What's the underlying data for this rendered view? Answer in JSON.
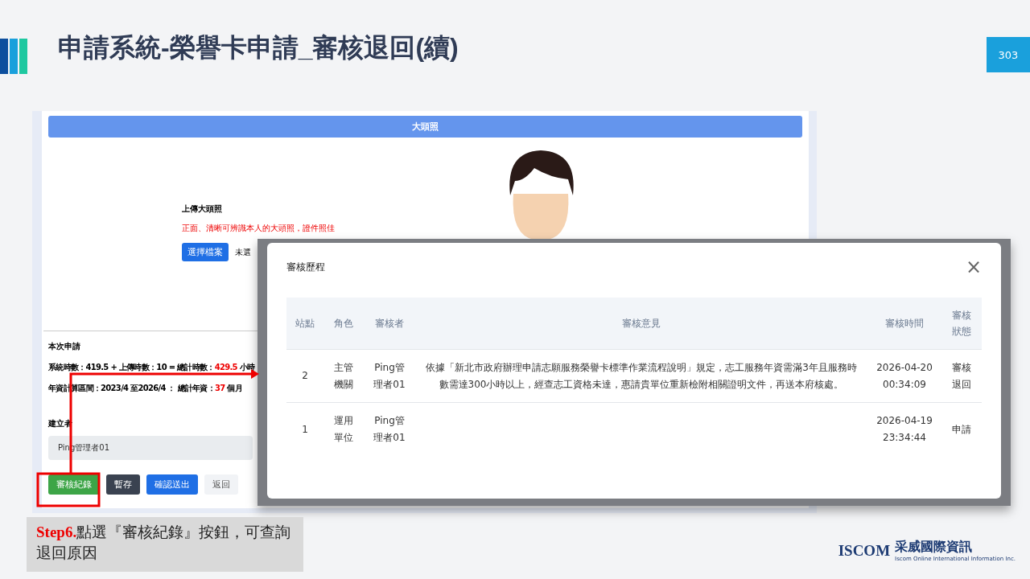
{
  "slide": {
    "title": "申請系統-榮譽卡申請_審核退回(續)",
    "page_number": "303"
  },
  "app": {
    "photo_bar_label": "大頭照",
    "upload_title": "上傳大頭照",
    "upload_hint": "正面、清晰可辨識本人的大頭照，證件照佳",
    "choose_file_button": "選擇檔案",
    "file_status": "未選",
    "summary_title": "本次申請",
    "summary_lines": [
      [
        {
          "text": "系統時數：419.5 + 上傳時數：10 = 總計時數：",
          "emphasis": false
        },
        {
          "text": "429.5",
          "emphasis": true
        },
        {
          "text": " 小時",
          "emphasis": false
        }
      ],
      [
        {
          "text": "年資計算區間：2023/4 至2026/4 ： 總計年資：",
          "emphasis": false
        },
        {
          "text": "37",
          "emphasis": true
        },
        {
          "text": " 個月",
          "emphasis": false
        }
      ]
    ],
    "creator_label": "建立者",
    "creator_value": "Ping管理者01",
    "buttons": [
      {
        "label": "審核紀錄",
        "kind": "success"
      },
      {
        "label": "暫存",
        "kind": "dark"
      },
      {
        "label": "確認送出",
        "kind": "primary"
      },
      {
        "label": "返回",
        "kind": "light"
      }
    ]
  },
  "modal": {
    "title": "審核歷程",
    "close": "×",
    "columns": [
      "站點",
      "角色",
      "審核者",
      "審核意見",
      "審核時間",
      "審核狀態"
    ],
    "rows": [
      {
        "station": "2",
        "role": "主管機關",
        "reviewer": "Ping管理者01",
        "opinion": "依據「新北市政府辦理申請志願服務榮譽卡標準作業流程說明」規定，志工服務年資需滿3年且服務時數需達300小時以上，經查志工資格未達，惠請貴單位重新檢附相關證明文件，再送本府核處。",
        "time": "2026-04-20 00:34:09",
        "status": "審核退回"
      },
      {
        "station": "1",
        "role": "運用單位",
        "reviewer": "Ping管理者01",
        "time": "2026-04-19 23:34:44",
        "status": "申請"
      }
    ]
  },
  "caption": {
    "step": "Step6.",
    "text": "點選『審核紀錄』按鈕，可查詢退回原因"
  },
  "logo": {
    "name": "ISCOM",
    "company": "采威國際資訊",
    "tagline": "Iscom Online International Information Inc."
  }
}
